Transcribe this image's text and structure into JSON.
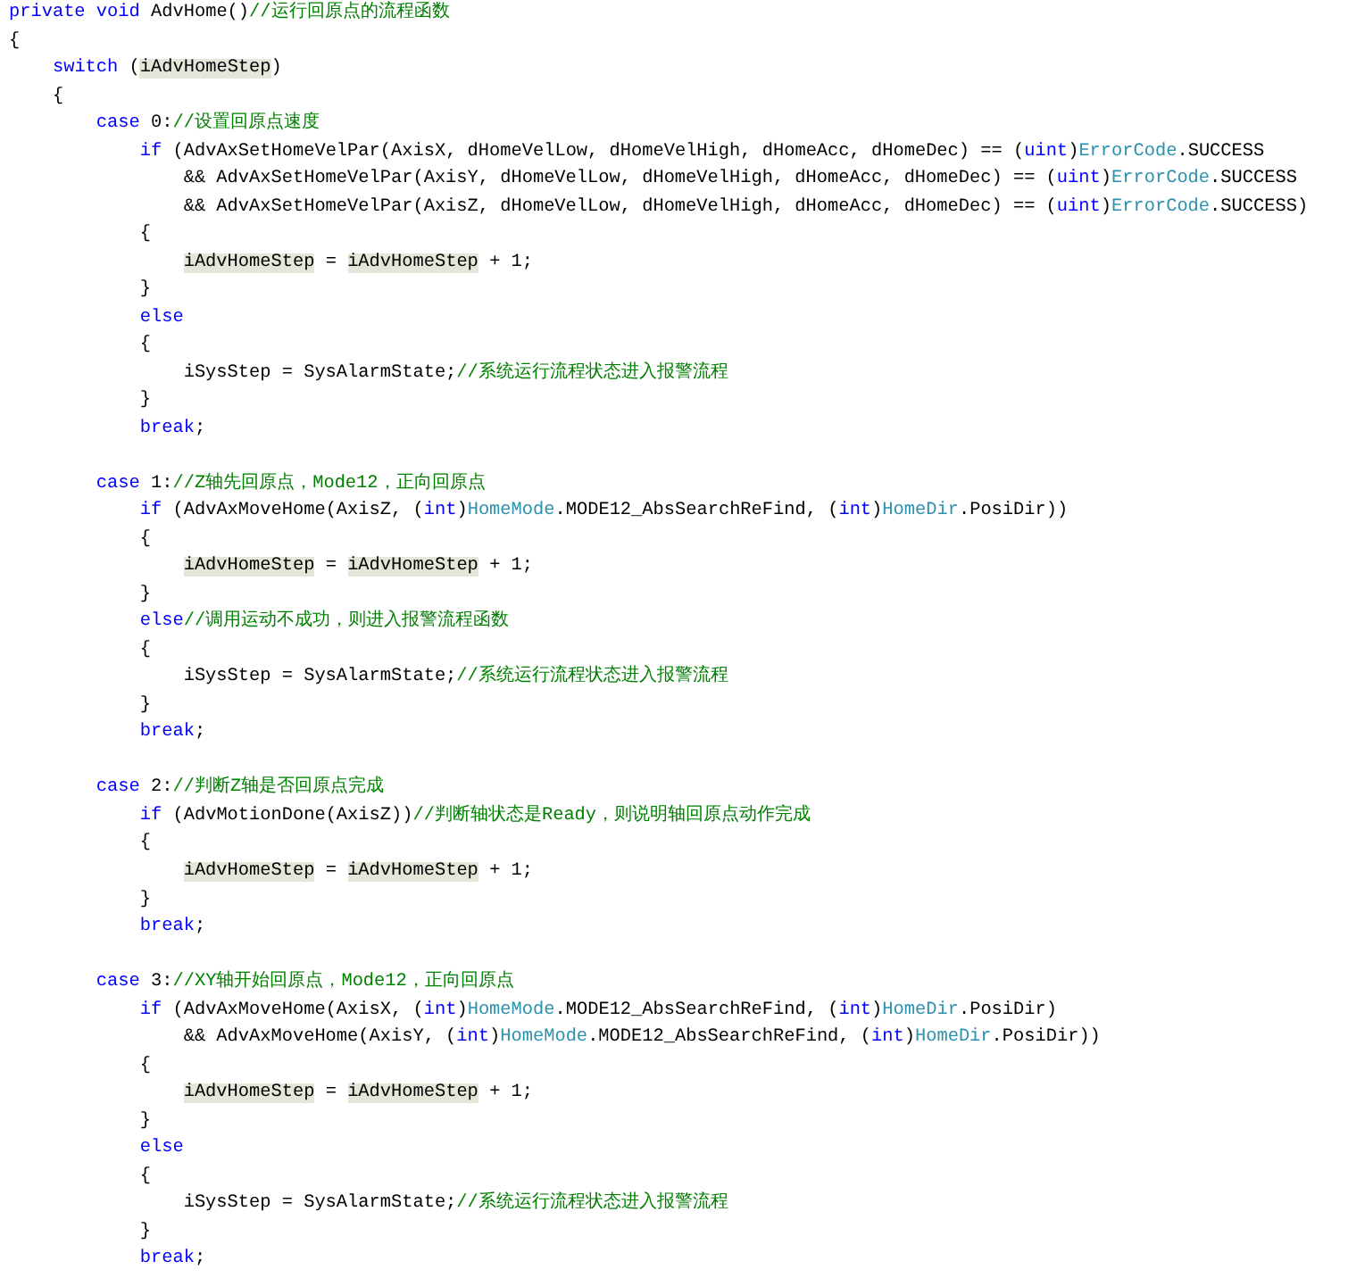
{
  "editor": {
    "lines": [
      {
        "kind": "code",
        "tokens": [
          {
            "kind": "keyword",
            "text": "private"
          },
          {
            "kind": "keyword",
            "text": " void"
          },
          {
            "kind": "plain",
            "text": " AdvHome()"
          },
          {
            "kind": "comment",
            "text": "//运行回原点的流程函数"
          }
        ]
      },
      {
        "kind": "code",
        "tokens": [
          {
            "kind": "plain",
            "text": "{"
          }
        ]
      },
      {
        "kind": "code",
        "tokens": [
          {
            "kind": "keyword",
            "text": "    switch"
          },
          {
            "kind": "plain",
            "text": " ("
          },
          {
            "kind": "highlight",
            "text": "iAdvHomeStep"
          },
          {
            "kind": "plain",
            "text": ")"
          }
        ]
      },
      {
        "kind": "code",
        "tokens": [
          {
            "kind": "plain",
            "text": "    {"
          }
        ]
      },
      {
        "kind": "code",
        "tokens": [
          {
            "kind": "keyword",
            "text": "        case"
          },
          {
            "kind": "plain",
            "text": " 0:"
          },
          {
            "kind": "comment",
            "text": "//设置回原点速度"
          }
        ]
      },
      {
        "kind": "code",
        "tokens": [
          {
            "kind": "keyword",
            "text": "            if"
          },
          {
            "kind": "plain",
            "text": " (AdvAxSetHomeVelPar(AxisX, dHomeVelLow, dHomeVelHigh, dHomeAcc, dHomeDec) == ("
          },
          {
            "kind": "keyword",
            "text": "uint"
          },
          {
            "kind": "plain",
            "text": ")"
          },
          {
            "kind": "type",
            "text": "ErrorCode"
          },
          {
            "kind": "plain",
            "text": ".SUCCESS"
          }
        ]
      },
      {
        "kind": "code",
        "tokens": [
          {
            "kind": "plain",
            "text": "                && AdvAxSetHomeVelPar(AxisY, dHomeVelLow, dHomeVelHigh, dHomeAcc, dHomeDec) == ("
          },
          {
            "kind": "keyword",
            "text": "uint"
          },
          {
            "kind": "plain",
            "text": ")"
          },
          {
            "kind": "type",
            "text": "ErrorCode"
          },
          {
            "kind": "plain",
            "text": ".SUCCESS"
          }
        ]
      },
      {
        "kind": "code",
        "tokens": [
          {
            "kind": "plain",
            "text": "                && AdvAxSetHomeVelPar(AxisZ, dHomeVelLow, dHomeVelHigh, dHomeAcc, dHomeDec) == ("
          },
          {
            "kind": "keyword",
            "text": "uint"
          },
          {
            "kind": "plain",
            "text": ")"
          },
          {
            "kind": "type",
            "text": "ErrorCode"
          },
          {
            "kind": "plain",
            "text": ".SUCCESS)"
          }
        ]
      },
      {
        "kind": "code",
        "tokens": [
          {
            "kind": "plain",
            "text": "            {"
          }
        ]
      },
      {
        "kind": "code",
        "tokens": [
          {
            "kind": "highlight",
            "text": "                iAdvHomeStep"
          },
          {
            "kind": "plain",
            "text": " = "
          },
          {
            "kind": "highlight",
            "text": "iAdvHomeStep"
          },
          {
            "kind": "plain",
            "text": " + 1;"
          }
        ]
      },
      {
        "kind": "code",
        "tokens": [
          {
            "kind": "plain",
            "text": "            }"
          }
        ]
      },
      {
        "kind": "code",
        "tokens": [
          {
            "kind": "keyword",
            "text": "            else"
          }
        ]
      },
      {
        "kind": "code",
        "tokens": [
          {
            "kind": "plain",
            "text": "            {"
          }
        ]
      },
      {
        "kind": "code",
        "tokens": [
          {
            "kind": "plain",
            "text": "                iSysStep = SysAlarmState;"
          },
          {
            "kind": "comment",
            "text": "//系统运行流程状态进入报警流程"
          }
        ]
      },
      {
        "kind": "code",
        "tokens": [
          {
            "kind": "plain",
            "text": "            }"
          }
        ]
      },
      {
        "kind": "code",
        "tokens": [
          {
            "kind": "keyword",
            "text": "            break"
          },
          {
            "kind": "plain",
            "text": ";"
          }
        ]
      },
      {
        "kind": "blank"
      },
      {
        "kind": "code",
        "tokens": [
          {
            "kind": "keyword",
            "text": "        case"
          },
          {
            "kind": "plain",
            "text": " 1:"
          },
          {
            "kind": "comment",
            "text": "//Z轴先回原点，Mode12，正向回原点"
          }
        ]
      },
      {
        "kind": "code",
        "tokens": [
          {
            "kind": "keyword",
            "text": "            if"
          },
          {
            "kind": "plain",
            "text": " (AdvAxMoveHome(AxisZ, ("
          },
          {
            "kind": "keyword",
            "text": "int"
          },
          {
            "kind": "plain",
            "text": ")"
          },
          {
            "kind": "type",
            "text": "HomeMode"
          },
          {
            "kind": "plain",
            "text": ".MODE12_AbsSearchReFind, ("
          },
          {
            "kind": "keyword",
            "text": "int"
          },
          {
            "kind": "plain",
            "text": ")"
          },
          {
            "kind": "type",
            "text": "HomeDir"
          },
          {
            "kind": "plain",
            "text": ".PosiDir))"
          }
        ]
      },
      {
        "kind": "code",
        "tokens": [
          {
            "kind": "plain",
            "text": "            {"
          }
        ]
      },
      {
        "kind": "code",
        "tokens": [
          {
            "kind": "highlight",
            "text": "                iAdvHomeStep"
          },
          {
            "kind": "plain",
            "text": " = "
          },
          {
            "kind": "highlight",
            "text": "iAdvHomeStep"
          },
          {
            "kind": "plain",
            "text": " + 1;"
          }
        ]
      },
      {
        "kind": "code",
        "tokens": [
          {
            "kind": "plain",
            "text": "            }"
          }
        ]
      },
      {
        "kind": "code",
        "tokens": [
          {
            "kind": "keyword",
            "text": "            else"
          },
          {
            "kind": "comment",
            "text": "//调用运动不成功，则进入报警流程函数"
          }
        ]
      },
      {
        "kind": "code",
        "tokens": [
          {
            "kind": "plain",
            "text": "            {"
          }
        ]
      },
      {
        "kind": "code",
        "tokens": [
          {
            "kind": "plain",
            "text": "                iSysStep = SysAlarmState;"
          },
          {
            "kind": "comment",
            "text": "//系统运行流程状态进入报警流程"
          }
        ]
      },
      {
        "kind": "code",
        "tokens": [
          {
            "kind": "plain",
            "text": "            }"
          }
        ]
      },
      {
        "kind": "code",
        "tokens": [
          {
            "kind": "keyword",
            "text": "            break"
          },
          {
            "kind": "plain",
            "text": ";"
          }
        ]
      },
      {
        "kind": "blank"
      },
      {
        "kind": "code",
        "tokens": [
          {
            "kind": "keyword",
            "text": "        case"
          },
          {
            "kind": "plain",
            "text": " 2:"
          },
          {
            "kind": "comment",
            "text": "//判断Z轴是否回原点完成"
          }
        ]
      },
      {
        "kind": "code",
        "tokens": [
          {
            "kind": "keyword",
            "text": "            if"
          },
          {
            "kind": "plain",
            "text": " (AdvMotionDone(AxisZ))"
          },
          {
            "kind": "comment",
            "text": "//判断轴状态是Ready，则说明轴回原点动作完成"
          }
        ]
      },
      {
        "kind": "code",
        "tokens": [
          {
            "kind": "plain",
            "text": "            {"
          }
        ]
      },
      {
        "kind": "code",
        "tokens": [
          {
            "kind": "highlight",
            "text": "                iAdvHomeStep"
          },
          {
            "kind": "plain",
            "text": " = "
          },
          {
            "kind": "highlight",
            "text": "iAdvHomeStep"
          },
          {
            "kind": "plain",
            "text": " + 1;"
          }
        ]
      },
      {
        "kind": "code",
        "tokens": [
          {
            "kind": "plain",
            "text": "            }"
          }
        ]
      },
      {
        "kind": "code",
        "tokens": [
          {
            "kind": "keyword",
            "text": "            break"
          },
          {
            "kind": "plain",
            "text": ";"
          }
        ]
      },
      {
        "kind": "blank"
      },
      {
        "kind": "code",
        "tokens": [
          {
            "kind": "keyword",
            "text": "        case"
          },
          {
            "kind": "plain",
            "text": " 3:"
          },
          {
            "kind": "comment",
            "text": "//XY轴开始回原点，Mode12，正向回原点"
          }
        ]
      },
      {
        "kind": "code",
        "tokens": [
          {
            "kind": "keyword",
            "text": "            if"
          },
          {
            "kind": "plain",
            "text": " (AdvAxMoveHome(AxisX, ("
          },
          {
            "kind": "keyword",
            "text": "int"
          },
          {
            "kind": "plain",
            "text": ")"
          },
          {
            "kind": "type",
            "text": "HomeMode"
          },
          {
            "kind": "plain",
            "text": ".MODE12_AbsSearchReFind, ("
          },
          {
            "kind": "keyword",
            "text": "int"
          },
          {
            "kind": "plain",
            "text": ")"
          },
          {
            "kind": "type",
            "text": "HomeDir"
          },
          {
            "kind": "plain",
            "text": ".PosiDir)"
          }
        ]
      },
      {
        "kind": "code",
        "tokens": [
          {
            "kind": "plain",
            "text": "                && AdvAxMoveHome(AxisY, ("
          },
          {
            "kind": "keyword",
            "text": "int"
          },
          {
            "kind": "plain",
            "text": ")"
          },
          {
            "kind": "type",
            "text": "HomeMode"
          },
          {
            "kind": "plain",
            "text": ".MODE12_AbsSearchReFind, ("
          },
          {
            "kind": "keyword",
            "text": "int"
          },
          {
            "kind": "plain",
            "text": ")"
          },
          {
            "kind": "type",
            "text": "HomeDir"
          },
          {
            "kind": "plain",
            "text": ".PosiDir))"
          }
        ]
      },
      {
        "kind": "code",
        "tokens": [
          {
            "kind": "plain",
            "text": "            {"
          }
        ]
      },
      {
        "kind": "code",
        "tokens": [
          {
            "kind": "highlight",
            "text": "                iAdvHomeStep"
          },
          {
            "kind": "plain",
            "text": " = "
          },
          {
            "kind": "highlight",
            "text": "iAdvHomeStep"
          },
          {
            "kind": "plain",
            "text": " + 1;"
          }
        ]
      },
      {
        "kind": "code",
        "tokens": [
          {
            "kind": "plain",
            "text": "            }"
          }
        ]
      },
      {
        "kind": "code",
        "tokens": [
          {
            "kind": "keyword",
            "text": "            else"
          }
        ]
      },
      {
        "kind": "code",
        "tokens": [
          {
            "kind": "plain",
            "text": "            {"
          }
        ]
      },
      {
        "kind": "code",
        "tokens": [
          {
            "kind": "plain",
            "text": "                iSysStep = SysAlarmState;"
          },
          {
            "kind": "comment",
            "text": "//系统运行流程状态进入报警流程"
          }
        ]
      },
      {
        "kind": "code",
        "tokens": [
          {
            "kind": "plain",
            "text": "            }"
          }
        ]
      },
      {
        "kind": "code",
        "tokens": [
          {
            "kind": "keyword",
            "text": "            break"
          },
          {
            "kind": "plain",
            "text": ";"
          }
        ]
      }
    ]
  }
}
